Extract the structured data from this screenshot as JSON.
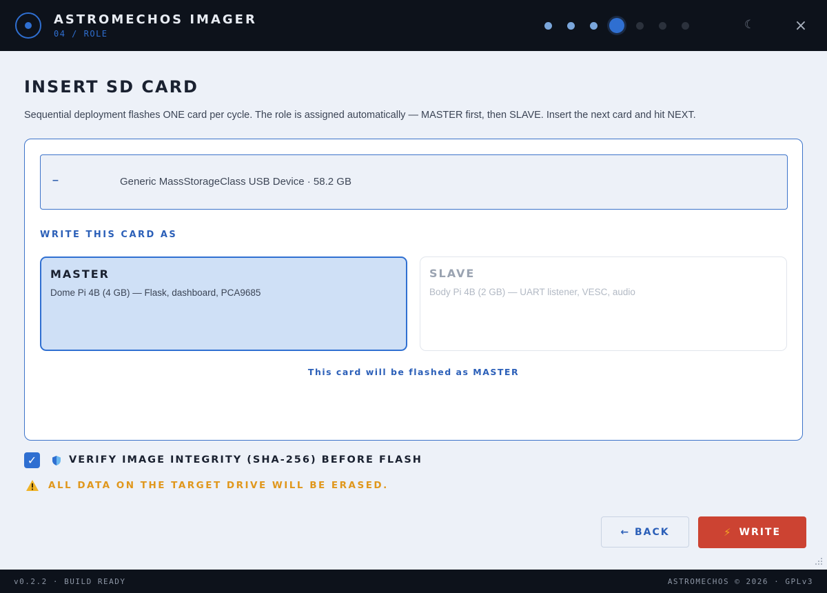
{
  "header": {
    "app_title": "ASTROMECHOS IMAGER",
    "step_label": "04 / ROLE",
    "steps": [
      {
        "state": "done"
      },
      {
        "state": "done"
      },
      {
        "state": "done"
      },
      {
        "state": "current"
      },
      {
        "state": "todo"
      },
      {
        "state": "todo"
      },
      {
        "state": "todo"
      }
    ],
    "theme_icon": "moon-icon",
    "close_icon": "close-icon",
    "close_symbol": "×",
    "theme_symbol": "☾"
  },
  "page": {
    "title": "INSERT SD CARD",
    "description": "Sequential deployment flashes ONE card per cycle. The role is assigned automatically — MASTER first, then SLAVE. Insert the next card and hit NEXT."
  },
  "device": {
    "indicator": "–",
    "name": "Generic MassStorageClass USB Device · 58.2 GB"
  },
  "role": {
    "heading": "WRITE THIS CARD AS",
    "options": [
      {
        "name": "MASTER",
        "description": "Dome Pi 4B (4 GB) — Flask, dashboard, PCA9685",
        "selected": true
      },
      {
        "name": "SLAVE",
        "description": "Body Pi 4B (2 GB) — UART listener, VESC, audio",
        "selected": false
      }
    ],
    "status": "This card will be flashed as MASTER"
  },
  "options": {
    "verify_checked": true,
    "verify_label": "VERIFY IMAGE INTEGRITY (SHA-256) BEFORE FLASH",
    "warning": "ALL DATA ON THE TARGET DRIVE WILL BE ERASED."
  },
  "actions": {
    "back_label": "← BACK",
    "write_label": "WRITE",
    "write_icon": "⚡"
  },
  "footer": {
    "left": "v0.2.2 · BUILD READY",
    "right": "ASTROMECHOS © 2026 · GPLv3"
  },
  "colors": {
    "accent": "#2f6fd1",
    "danger": "#cc4332",
    "warning": "#e0971c",
    "header_bg": "#0d121b"
  }
}
